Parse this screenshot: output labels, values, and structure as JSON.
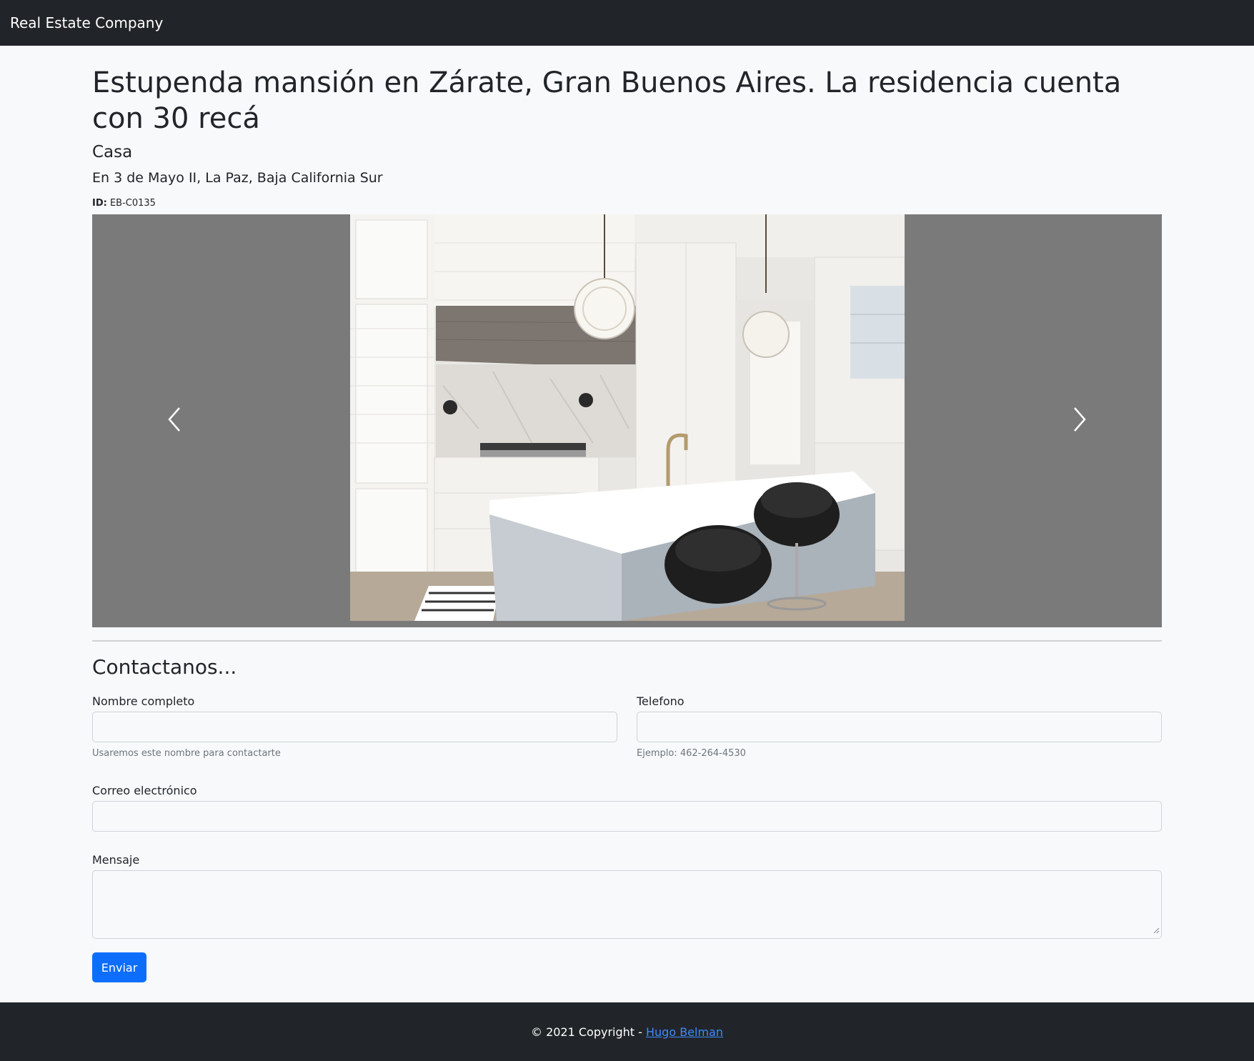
{
  "navbar": {
    "brand": "Real Estate Company"
  },
  "property": {
    "title": "Estupenda mansión en Zárate, Gran Buenos Aires. La residencia cuenta con 30 recá",
    "type": "Casa",
    "location": "En 3 de Mayo II, La Paz, Baja California Sur",
    "id_label": "ID:",
    "id_value": "EB-C0135"
  },
  "carousel": {
    "prev_icon": "chevron-left-icon",
    "next_icon": "chevron-right-icon",
    "image": "kitchen-photo"
  },
  "contact": {
    "heading": "Contactanos...",
    "name_label": "Nombre completo",
    "name_help": "Usaremos este nombre para contactarte",
    "name_value": "",
    "phone_label": "Telefono",
    "phone_help": "Ejemplo: 462-264-4530",
    "phone_value": "",
    "email_label": "Correo electrónico",
    "email_value": "",
    "message_label": "Mensaje",
    "message_value": "",
    "submit_label": "Enviar"
  },
  "footer": {
    "copyright": "© 2021 Copyright - ",
    "author_link": "Hugo Belman"
  },
  "colors": {
    "navbar_bg": "#212529",
    "page_bg": "#f8f9fa",
    "carousel_bg": "#7a7a7a",
    "primary": "#0d6efd"
  }
}
